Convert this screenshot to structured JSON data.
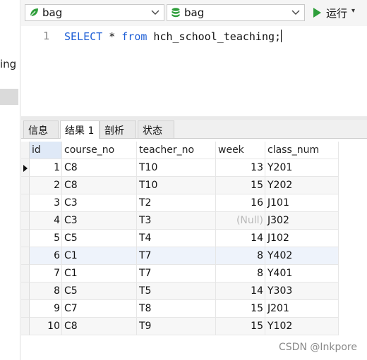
{
  "left_panel": {
    "partial_text": "ing"
  },
  "toolbar": {
    "connection": {
      "value": "bag",
      "icon": "leaf-icon",
      "icon_color": "#2e9e3a"
    },
    "database": {
      "value": "bag",
      "icon": "database-icon",
      "icon_color": "#2e9e3a"
    },
    "run_label": "运行",
    "run_dropdown": "▾"
  },
  "editor": {
    "line_number": "1",
    "sql_keyword_select": "SELECT",
    "sql_star": " * ",
    "sql_keyword_from": "from",
    "sql_rest": " hch_school_teaching;"
  },
  "tabs": [
    {
      "label": "信息"
    },
    {
      "label": "结果 1"
    },
    {
      "label": "剖析"
    },
    {
      "label": "状态"
    }
  ],
  "grid": {
    "columns": [
      "id",
      "course_no",
      "teacher_no",
      "week",
      "class_num"
    ],
    "rows": [
      {
        "id": "1",
        "course_no": "C8",
        "teacher_no": "T10",
        "week": "13",
        "class_num": "Y201"
      },
      {
        "id": "2",
        "course_no": "C8",
        "teacher_no": "T10",
        "week": "15",
        "class_num": "Y202"
      },
      {
        "id": "3",
        "course_no": "C3",
        "teacher_no": "T2",
        "week": "16",
        "class_num": "J101"
      },
      {
        "id": "4",
        "course_no": "C3",
        "teacher_no": "T3",
        "week": "(Null)",
        "class_num": "J302"
      },
      {
        "id": "5",
        "course_no": "C5",
        "teacher_no": "T4",
        "week": "14",
        "class_num": "J102"
      },
      {
        "id": "6",
        "course_no": "C1",
        "teacher_no": "T7",
        "week": "8",
        "class_num": "Y402"
      },
      {
        "id": "7",
        "course_no": "C1",
        "teacher_no": "T7",
        "week": "8",
        "class_num": "Y401"
      },
      {
        "id": "8",
        "course_no": "C5",
        "teacher_no": "T5",
        "week": "14",
        "class_num": "Y303"
      },
      {
        "id": "9",
        "course_no": "C7",
        "teacher_no": "T8",
        "week": "15",
        "class_num": "J201"
      },
      {
        "id": "10",
        "course_no": "C8",
        "teacher_no": "T9",
        "week": "15",
        "class_num": "Y102"
      }
    ]
  },
  "watermark": "CSDN @Inkpore"
}
